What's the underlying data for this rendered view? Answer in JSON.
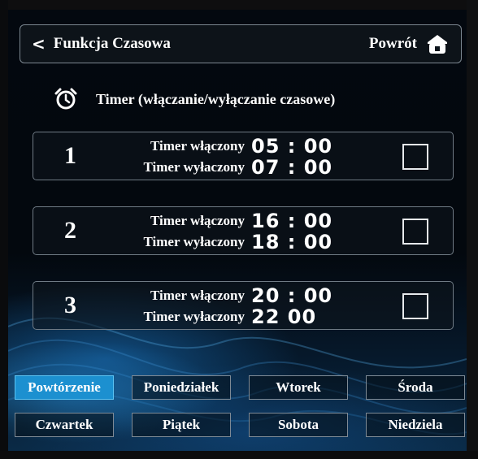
{
  "header": {
    "back_chevron": "<",
    "title": "Funkcja Czasowa",
    "return_label": "Powrót"
  },
  "section": {
    "title": "Timer (włączanie/wyłączanie czasowe)"
  },
  "timers": [
    {
      "index": "1",
      "on_label": "Timer włączony",
      "on_time": "05 : 00",
      "off_label": "Timer wyłaczony",
      "off_time": "07 : 00",
      "checked": false
    },
    {
      "index": "2",
      "on_label": "Timer włączony",
      "on_time": "16 : 00",
      "off_label": "Timer wyłaczony",
      "off_time": "18 : 00",
      "checked": false
    },
    {
      "index": "3",
      "on_label": "Timer włączony",
      "on_time": "20 : 00",
      "off_label": "Timer wyłaczony",
      "off_time": "22  00",
      "checked": false
    }
  ],
  "days": [
    {
      "label": "Powtórzenie",
      "active": true
    },
    {
      "label": "Poniedziałek",
      "active": false
    },
    {
      "label": "Wtorek",
      "active": false
    },
    {
      "label": "Środa",
      "active": false
    },
    {
      "label": "Czwartek",
      "active": false
    },
    {
      "label": "Piątek",
      "active": false
    },
    {
      "label": "Sobota",
      "active": false
    },
    {
      "label": "Niedziela",
      "active": false
    }
  ],
  "colors": {
    "accent": "#1c90d0",
    "background": "#02070c",
    "border": "#7c8791"
  },
  "icons": {
    "back": "chevron-left-icon",
    "home": "home-icon",
    "alarm": "alarm-clock-icon"
  }
}
